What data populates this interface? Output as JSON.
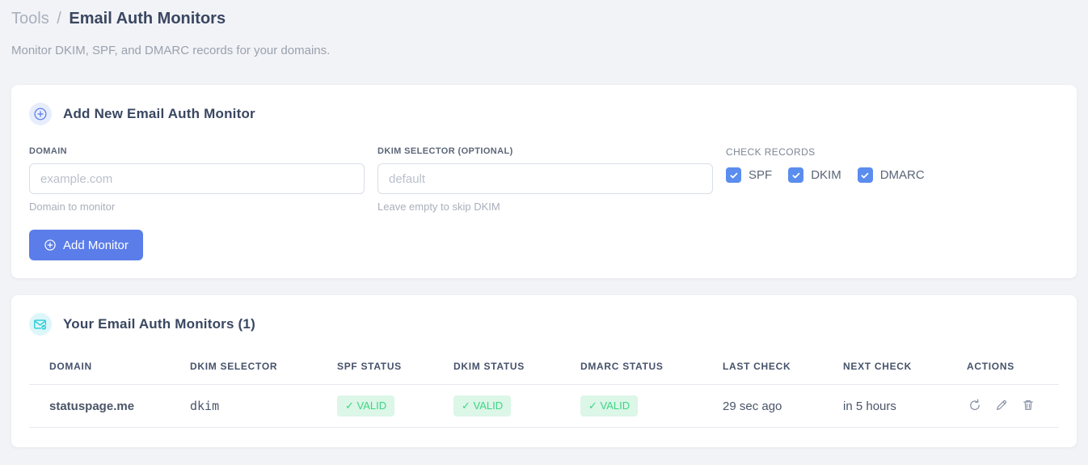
{
  "header": {
    "breadcrumb": {
      "section": "Tools",
      "separator": "/",
      "current": "Email Auth Monitors"
    },
    "subtitle": "Monitor DKIM, SPF, and DMARC records for your domains."
  },
  "add_monitor_card": {
    "icon": "plus-circle-icon",
    "title": "Add New Email Auth Monitor",
    "domain_field": {
      "label": "DOMAIN",
      "placeholder": "example.com",
      "value": "",
      "helper": "Domain to monitor"
    },
    "dkim_field": {
      "label": "DKIM SELECTOR (OPTIONAL)",
      "placeholder": "default",
      "value": "",
      "helper": "Leave empty to skip DKIM"
    },
    "check_records": {
      "label": "CHECK RECORDS",
      "options": [
        {
          "label": "SPF",
          "checked": true
        },
        {
          "label": "DKIM",
          "checked": true
        },
        {
          "label": "DMARC",
          "checked": true
        }
      ]
    },
    "submit_label": "Add Monitor"
  },
  "monitors_card": {
    "icon": "envelope-check-icon",
    "title": "Your Email Auth Monitors (1)",
    "table": {
      "headers": [
        "DOMAIN",
        "DKIM SELECTOR",
        "SPF STATUS",
        "DKIM STATUS",
        "DMARC STATUS",
        "LAST CHECK",
        "NEXT CHECK",
        "ACTIONS"
      ],
      "rows": [
        {
          "domain": "statuspage.me",
          "dkim_selector": "dkim",
          "spf_status": "✓ VALID",
          "dkim_status": "✓ VALID",
          "dmarc_status": "✓ VALID",
          "last_check": "29 sec ago",
          "next_check": "in 5 hours",
          "actions": [
            "refresh-icon",
            "edit-icon",
            "delete-icon"
          ]
        }
      ]
    }
  },
  "colors": {
    "page_background": "#f2f3f7",
    "primary_blue": "#5b7de9",
    "checkbox_blue": "#5a8dee",
    "icon_cyan": "#26ccd8",
    "badge_green_text": "#3bd683",
    "badge_green_bg": "#dcf6e8",
    "selector_pink": "#ed3f8c",
    "heading_navy": "#3a4761"
  }
}
